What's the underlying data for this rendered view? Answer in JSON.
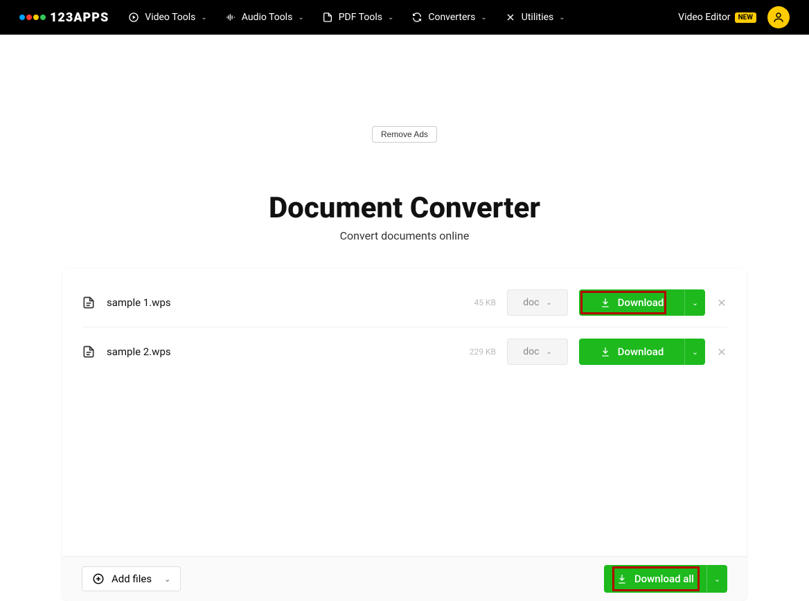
{
  "logo_text": "123APPS",
  "nav": [
    {
      "label": "Video Tools"
    },
    {
      "label": "Audio Tools"
    },
    {
      "label": "PDF Tools"
    },
    {
      "label": "Converters"
    },
    {
      "label": "Utilities"
    }
  ],
  "header_right": {
    "video_editor": "Video Editor",
    "new_badge": "NEW"
  },
  "remove_ads": "Remove Ads",
  "title": "Document Converter",
  "subtitle": "Convert documents online",
  "files": [
    {
      "name": "sample 1.wps",
      "size": "45 KB",
      "format": "doc",
      "download": "Download",
      "highlighted": true
    },
    {
      "name": "sample 2.wps",
      "size": "229 KB",
      "format": "doc",
      "download": "Download",
      "highlighted": false
    }
  ],
  "footer": {
    "add_files": "Add files",
    "download_all": "Download all"
  }
}
